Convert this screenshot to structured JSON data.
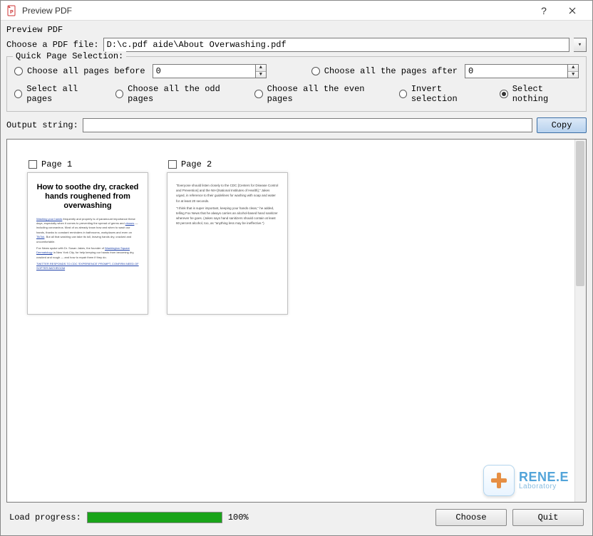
{
  "window": {
    "title": "Preview PDF"
  },
  "header": {
    "label": "Preview PDF"
  },
  "file": {
    "label": "Choose a PDF file:",
    "path": "D:\\c.pdf aide\\About Overwashing.pdf"
  },
  "qps": {
    "legend": "Quick Page Selection:",
    "before": {
      "label": "Choose all pages before",
      "value": "0"
    },
    "after": {
      "label": "Choose all the pages after",
      "value": "0"
    },
    "select_all": "Select all pages",
    "odd": "Choose all the odd pages",
    "even": "Choose all the even pages",
    "invert": "Invert selection",
    "nothing": "Select nothing",
    "selected": "nothing"
  },
  "output": {
    "label": "Output string:",
    "value": "",
    "copy": "Copy"
  },
  "pages": [
    {
      "label": "Page 1",
      "checked": false,
      "headline": "How to soothe dry, cracked hands roughened from overwashing"
    },
    {
      "label": "Page 2",
      "checked": false
    }
  ],
  "branding": {
    "name": "RENE.E",
    "sub": "Laboratory"
  },
  "footer": {
    "progress_label": "Load progress:",
    "progress_pct": "100%",
    "progress_value": 100,
    "choose": "Choose",
    "quit": "Quit"
  }
}
